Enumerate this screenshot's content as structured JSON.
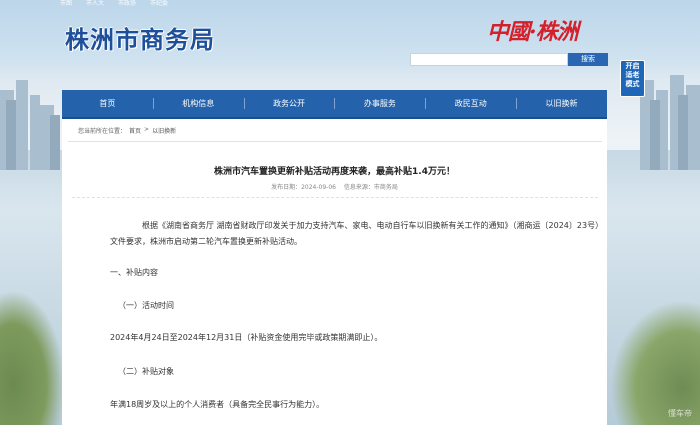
{
  "top_strip": [
    "市图",
    "市人大",
    "市政协",
    "市纪委"
  ],
  "site_title": "株洲市商务局",
  "calligraphy": "中國·株洲",
  "search": {
    "placeholder": "",
    "button": "搜索"
  },
  "elder_mode": {
    "line1": "开启",
    "line2": "适老",
    "line3": "模式"
  },
  "nav": [
    "首页",
    "机构信息",
    "政务公开",
    "办事服务",
    "政民互动",
    "以旧换新"
  ],
  "breadcrumb": {
    "prefix": "您当前所在位置：",
    "home": "首页",
    "sep": ">",
    "current": "以旧换新"
  },
  "article": {
    "title": "株洲市汽车置换更新补贴活动再度来袭，最高补贴1.4万元！",
    "publish_date": "发布日期：2024-09-06",
    "source": "信息来源：市商务局",
    "intro": "根据《湖南省商务厅 湖南省财政厅印发关于加力支持汽车、家电、电动自行车以旧换新有关工作的通知》（湘商运〔2024〕23号）文件要求，株洲市启动第二轮汽车置换更新补贴活动。",
    "section1": "一、补贴内容",
    "sub1": "（一）活动时间",
    "time_text": "2024年4月24日至2024年12月31日（补贴资金使用完毕或政策期满即止）。",
    "sub2": "（二）补贴对象",
    "target_text": "年满18周岁及以上的个人消费者（具备完全民事行为能力）。"
  },
  "watermark": "懂车帝"
}
